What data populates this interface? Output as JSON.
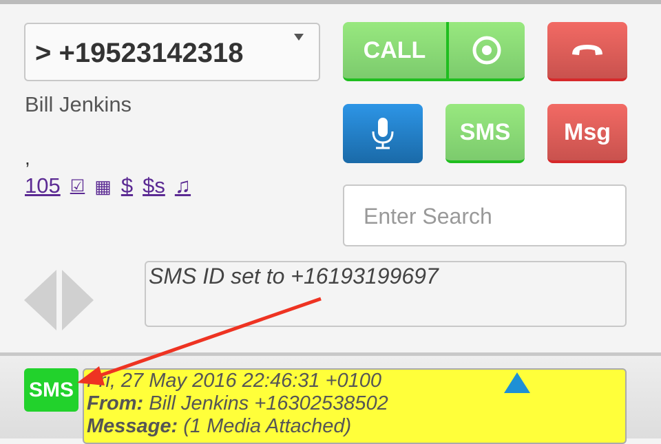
{
  "dialer": {
    "value": "> +19523142318"
  },
  "contact": {
    "name": "Bill Jenkins",
    "comma": ",",
    "links": [
      "105",
      "☑",
      "▦",
      "$",
      "$s",
      "♫"
    ]
  },
  "buttons": {
    "call": "CALL",
    "sms": "SMS",
    "msg": "Msg"
  },
  "search": {
    "placeholder": "Enter Search"
  },
  "status": {
    "text": "SMS ID set to +16193199697"
  },
  "message": {
    "badge": "SMS",
    "date": "Fri, 27 May 2016 22:46:31 +0100",
    "from_label": "From:",
    "from": "Bill Jenkins +16302538502",
    "message_label": "Message:",
    "message": "(1 Media Attached)"
  },
  "colors": {
    "green": "#7ccb6d",
    "red": "#c9524e",
    "blue": "#1a6aa8",
    "highlight": "#ffff3a",
    "annotation_arrow": "#ee3322"
  }
}
